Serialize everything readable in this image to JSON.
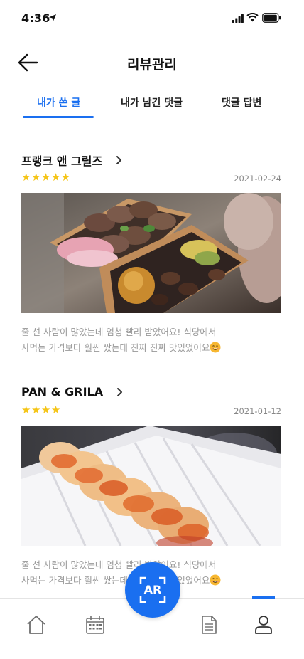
{
  "status_bar": {
    "time": "4:36"
  },
  "header": {
    "title": "리뷰관리"
  },
  "tabs": [
    {
      "label": "내가 쓴 글",
      "active": true
    },
    {
      "label": "내가 남긴 댓글",
      "active": false
    },
    {
      "label": "댓글 답변",
      "active": false
    }
  ],
  "reviews": [
    {
      "restaurant": "프랭크 앤 그릴즈",
      "stars": "★★★★★",
      "rating": 5,
      "date": "2021-02-24",
      "text_line1": "줄 선 사람이 많았는데 엄청 빨리 받았어요! 식당에서",
      "text_line2": "사먹는 가격보다 훨씬 쌌는데 진짜 진짜 맛있었어요",
      "emoji": "smiling-face-icon"
    },
    {
      "restaurant": "PAN & GRILA",
      "stars": "★★★★",
      "rating": 4,
      "date": "2021-01-12",
      "text_line1": "줄 선 사람이 많았는데 엄청 빨리 받았어요! 식당에서",
      "text_line2": "사먹는 가격보다 훨씬 쌌는데 진짜 진짜 맛있었어요",
      "emoji": "smiling-face-icon"
    }
  ],
  "bottom_nav": {
    "items": [
      "home-icon",
      "calendar-icon",
      "document-icon",
      "profile-icon"
    ],
    "active": "profile-icon",
    "ar_label": "AR"
  },
  "colors": {
    "accent": "#1a6ff0",
    "star": "#f5c518",
    "muted_text": "#999999"
  }
}
